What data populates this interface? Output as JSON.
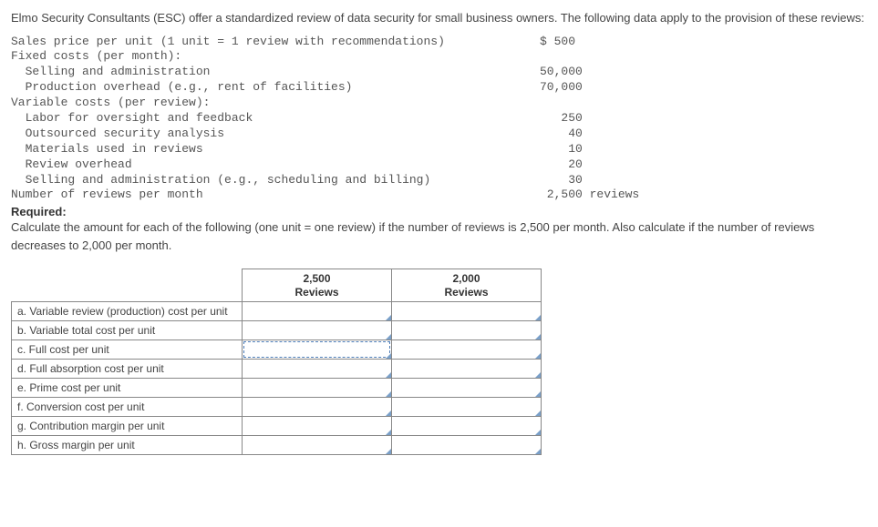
{
  "intro": "Elmo Security Consultants (ESC) offer a standardized review of data security for small business owners. The following data apply to the provision of these reviews:",
  "data_rows": [
    {
      "label": "Sales price per unit (1 unit = 1 review with recommendations)",
      "value": "$ 500",
      "suffix": ""
    },
    {
      "label": "Fixed costs (per month):",
      "value": "",
      "suffix": ""
    },
    {
      "label": "  Selling and administration",
      "value": "50,000",
      "suffix": ""
    },
    {
      "label": "  Production overhead (e.g., rent of facilities)",
      "value": "70,000",
      "suffix": ""
    },
    {
      "label": "Variable costs (per review):",
      "value": "",
      "suffix": ""
    },
    {
      "label": "  Labor for oversight and feedback",
      "value": "   250",
      "suffix": ""
    },
    {
      "label": "  Outsourced security analysis",
      "value": "    40",
      "suffix": ""
    },
    {
      "label": "  Materials used in reviews",
      "value": "    10",
      "suffix": ""
    },
    {
      "label": "  Review overhead",
      "value": "    20",
      "suffix": ""
    },
    {
      "label": "  Selling and administration (e.g., scheduling and billing)",
      "value": "    30",
      "suffix": ""
    },
    {
      "label": "Number of reviews per month",
      "value": " 2,500",
      "suffix": " reviews"
    }
  ],
  "required_label": "Required:",
  "required_text": "Calculate the amount for each of the following (one unit = one review) if the number of reviews is 2,500 per month. Also calculate if the number of reviews decreases to 2,000 per month.",
  "table": {
    "col1": "2,500 Reviews",
    "col2": "2,000 Reviews",
    "rows": [
      {
        "label": "a. Variable review (production) cost per unit"
      },
      {
        "label": "b. Variable total cost per unit"
      },
      {
        "label": "c. Full cost per unit"
      },
      {
        "label": "d. Full absorption cost per unit"
      },
      {
        "label": "e. Prime cost per unit"
      },
      {
        "label": "f. Conversion cost per unit"
      },
      {
        "label": "g. Contribution margin per unit"
      },
      {
        "label": "h. Gross margin per unit"
      }
    ]
  }
}
